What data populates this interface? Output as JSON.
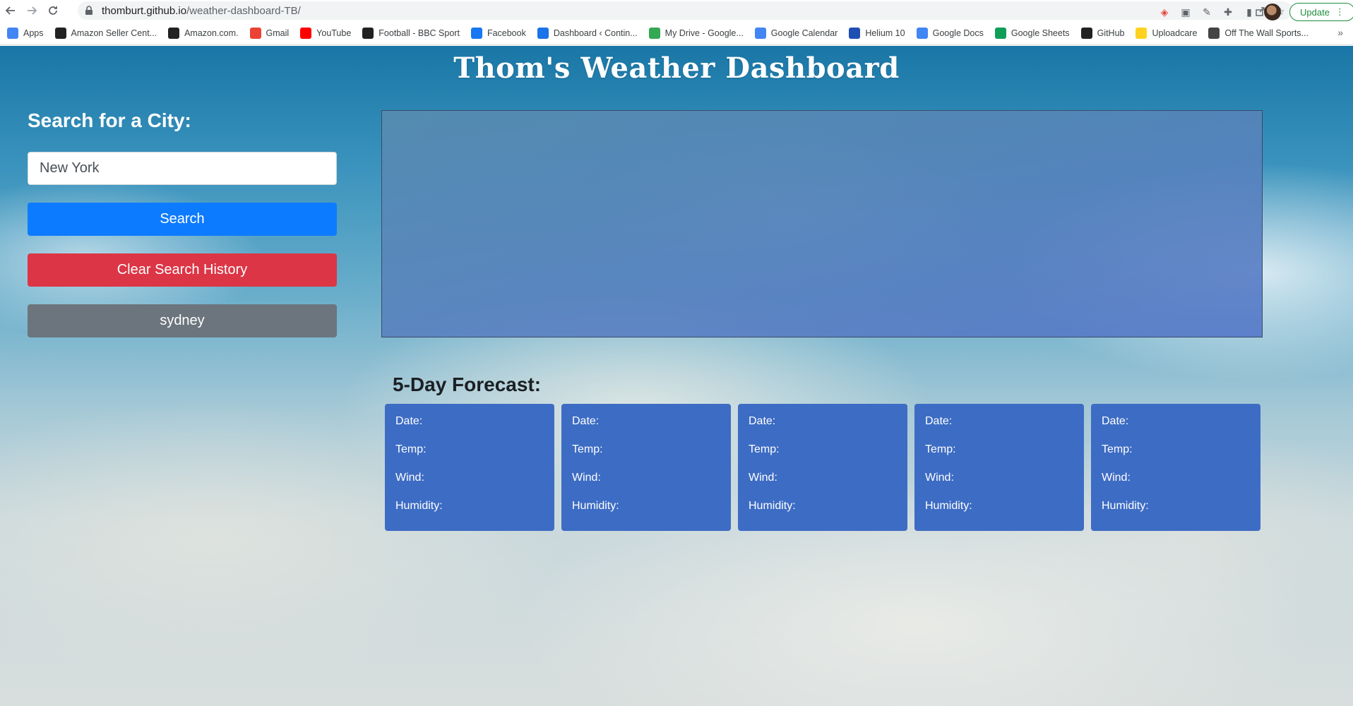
{
  "browser": {
    "url_host": "thomburt.github.io",
    "url_path": "/weather-dashboard-TB/",
    "update_label": "Update",
    "bookmarks": [
      {
        "label": "Apps",
        "icon": "apps-grid-icon",
        "color": "#4285f4"
      },
      {
        "label": "Amazon Seller Cent...",
        "icon": "amazon-icon",
        "color": "#222222"
      },
      {
        "label": "Amazon.com.",
        "icon": "amazon-smile-icon",
        "color": "#222222"
      },
      {
        "label": "Gmail",
        "icon": "gmail-icon",
        "color": "#ea4335"
      },
      {
        "label": "YouTube",
        "icon": "youtube-icon",
        "color": "#ff0000"
      },
      {
        "label": "Football - BBC Sport",
        "icon": "bbc-icon",
        "color": "#222222"
      },
      {
        "label": "Facebook",
        "icon": "facebook-icon",
        "color": "#1877f2"
      },
      {
        "label": "Dashboard ‹ Contin...",
        "icon": "dashboard-icon",
        "color": "#1a73e8"
      },
      {
        "label": "My Drive - Google...",
        "icon": "drive-icon",
        "color": "#34a853"
      },
      {
        "label": "Google Calendar",
        "icon": "calendar-icon",
        "color": "#4285f4"
      },
      {
        "label": "Helium 10",
        "icon": "helium-icon",
        "color": "#1f4fb3"
      },
      {
        "label": "Google Docs",
        "icon": "docs-icon",
        "color": "#4285f4"
      },
      {
        "label": "Google Sheets",
        "icon": "sheets-icon",
        "color": "#0f9d58"
      },
      {
        "label": "GitHub",
        "icon": "github-icon",
        "color": "#222222"
      },
      {
        "label": "Uploadcare",
        "icon": "uploadcare-icon",
        "color": "#ffd21f"
      },
      {
        "label": "Off The Wall Sports...",
        "icon": "globe-icon",
        "color": "#444444"
      }
    ]
  },
  "page": {
    "title": "Thom's Weather Dashboard",
    "search_heading": "Search for a City:",
    "search_input_value": "New York",
    "search_button": "Search",
    "clear_button": "Clear Search History",
    "history": [
      "sydney"
    ],
    "forecast_heading": "5-Day Forecast:",
    "forecast_labels": [
      "Date:",
      "Temp:",
      "Wind:",
      "Humidity:"
    ],
    "forecast_cards": [
      {
        "date": "Date:",
        "temp": "Temp:",
        "wind": "Wind:",
        "humidity": "Humidity:"
      },
      {
        "date": "Date:",
        "temp": "Temp:",
        "wind": "Wind:",
        "humidity": "Humidity:"
      },
      {
        "date": "Date:",
        "temp": "Temp:",
        "wind": "Wind:",
        "humidity": "Humidity:"
      },
      {
        "date": "Date:",
        "temp": "Temp:",
        "wind": "Wind:",
        "humidity": "Humidity:"
      },
      {
        "date": "Date:",
        "temp": "Temp:",
        "wind": "Wind:",
        "humidity": "Humidity:"
      }
    ]
  },
  "colors": {
    "search_button": "#0d7bff",
    "clear_button": "#dc3545",
    "history_button": "#6c757d",
    "forecast_card": "#3d6cc4"
  }
}
